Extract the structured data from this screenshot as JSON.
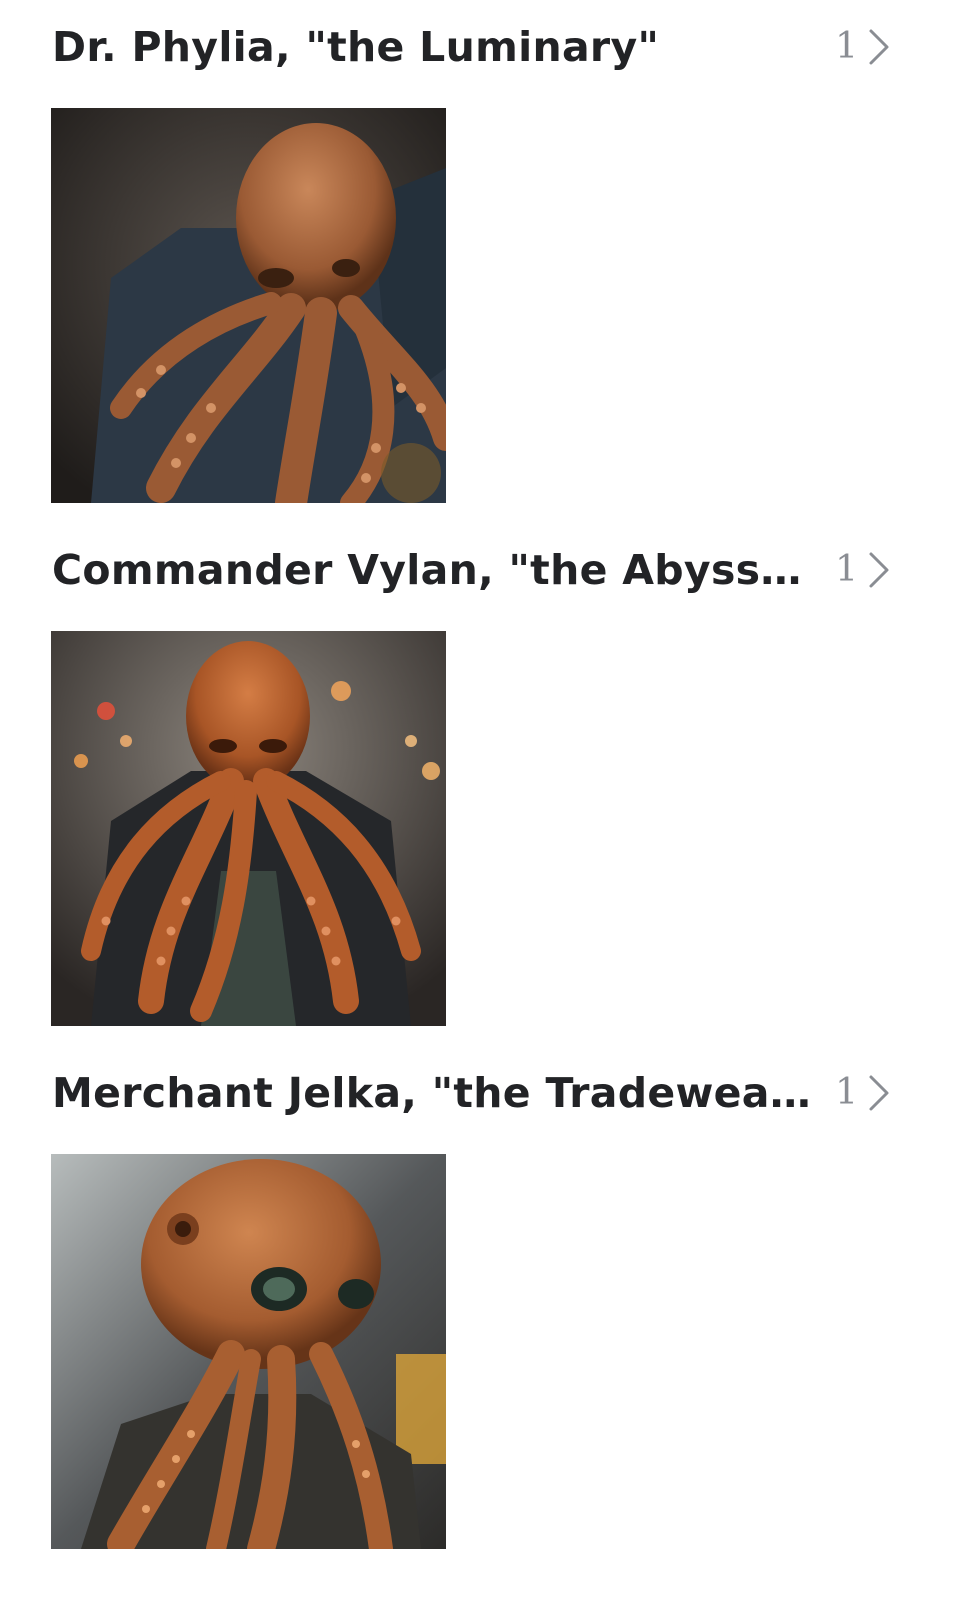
{
  "collections": [
    {
      "title": "Dr. Phylia, \"the Luminary\"",
      "count": "1",
      "image": "octopus-portrait-dark-coat",
      "colors": {
        "bg": "#3a3633",
        "skin": "#a4623b",
        "skin_dark": "#6b3b22",
        "coat": "#2e3a45"
      }
    },
    {
      "title": "Commander Vylan, \"the Abyssa...",
      "count": "1",
      "image": "octopus-portrait-leather-jacket",
      "colors": {
        "bg": "#4a4440",
        "skin": "#b8612f",
        "skin_dark": "#7a3a1c",
        "coat": "#26282a"
      }
    },
    {
      "title": "Merchant Jelka, \"the Tradewea...",
      "count": "1",
      "image": "octopus-portrait-city-street",
      "colors": {
        "bg": "#6b6d6c",
        "skin": "#b46a3a",
        "skin_dark": "#73401f",
        "coat": "#33332f"
      }
    }
  ],
  "icons": {
    "chevron": "chevron-right-icon"
  }
}
